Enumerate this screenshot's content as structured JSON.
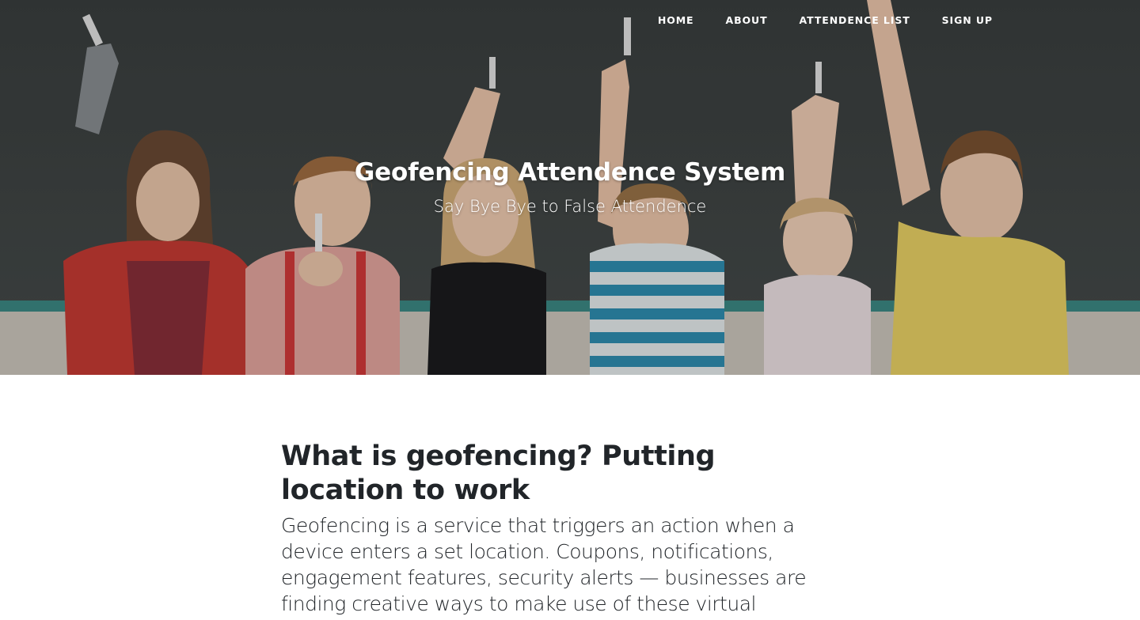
{
  "nav": {
    "items": [
      {
        "label": "HOME"
      },
      {
        "label": "ABOUT"
      },
      {
        "label": "ATTENDENCE LIST"
      },
      {
        "label": "SIGN UP"
      }
    ]
  },
  "hero": {
    "title": "Geofencing Attendence System",
    "subtitle": "Say Bye Bye to False Attendence",
    "image_icon": "children-at-chalkboard-photo"
  },
  "article": {
    "heading": "What is geofencing? Putting location to work",
    "body": "Geofencing is a service that triggers an action when a device enters a set location. Coupons, notifications, engagement features, security alerts — businesses are finding creative ways to make use of these virtual"
  },
  "colors": {
    "hero_bg": "#3d3f3f",
    "chalkboard": "#3e4444",
    "text_dark": "#212529",
    "nav_text": "#ffffff"
  }
}
